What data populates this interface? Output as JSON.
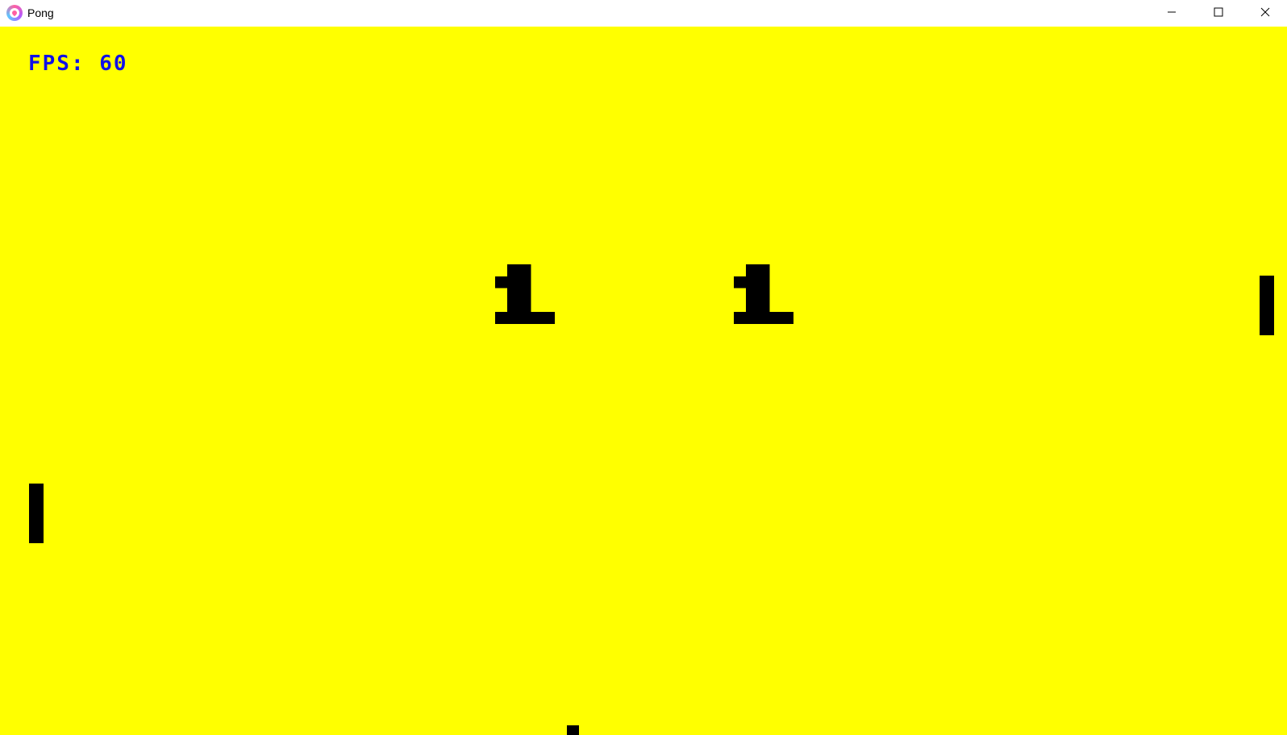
{
  "window": {
    "title": "Pong",
    "app_icon": "love2d-heart-icon",
    "controls": {
      "minimize_icon": "minimize-icon",
      "maximize_icon": "maximize-icon",
      "close_icon": "close-icon"
    }
  },
  "game": {
    "background_color": "#ffff00",
    "fps_label": "FPS: 60",
    "fps_color": "#1010e8",
    "score_left": "1",
    "score_right": "1",
    "foreground_color": "#000000"
  }
}
